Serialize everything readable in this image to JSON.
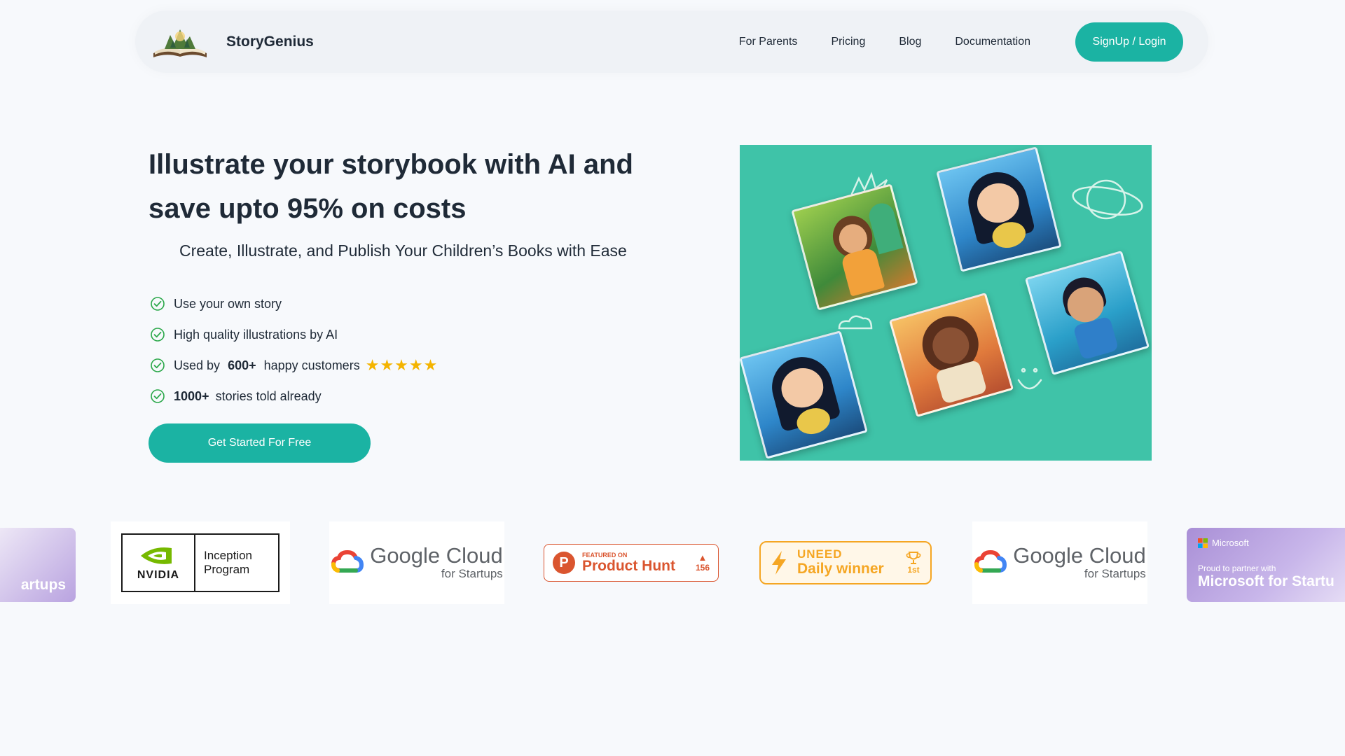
{
  "nav": {
    "brand": "StoryGenius",
    "links": [
      "For Parents",
      "Pricing",
      "Blog",
      "Documentation"
    ],
    "signup": "SignUp / Login"
  },
  "hero": {
    "title": "Illustrate your storybook with AI and save upto 95% on costs",
    "subtitle": "Create, Illustrate, and Publish Your Children’s Books with Ease",
    "features": [
      {
        "pre": "",
        "bold": "",
        "text": "Use your own story"
      },
      {
        "pre": "",
        "bold": "",
        "text": "High quality illustrations by AI"
      },
      {
        "pre": "Used by",
        "bold": "600+",
        "text": "happy customers"
      },
      {
        "pre": "",
        "bold": "1000+",
        "text": "stories told already"
      }
    ],
    "rating_stars": 5,
    "cta": "Get Started For Free"
  },
  "partners": {
    "microsoft_partial_left": "artups",
    "nvidia": {
      "brand": "NVIDIA",
      "line1": "Inception",
      "line2": "Program"
    },
    "google_cloud": {
      "name": "Google Cloud",
      "sub": "for Startups"
    },
    "product_hunt": {
      "featured": "FEATURED ON",
      "name": "Product Hunt",
      "votes": "156"
    },
    "uneed": {
      "brand": "UNEED",
      "label": "Daily winner",
      "rank": "1st"
    },
    "microsoft": {
      "brand": "Microsoft",
      "line1": "Proud to partner with",
      "line2": "Microsoft for Startu"
    }
  },
  "colors": {
    "accent": "#1bb3a3",
    "hero_bg": "#3fc3a8",
    "star": "#f4b400",
    "page_bg": "#f7f9fc"
  }
}
